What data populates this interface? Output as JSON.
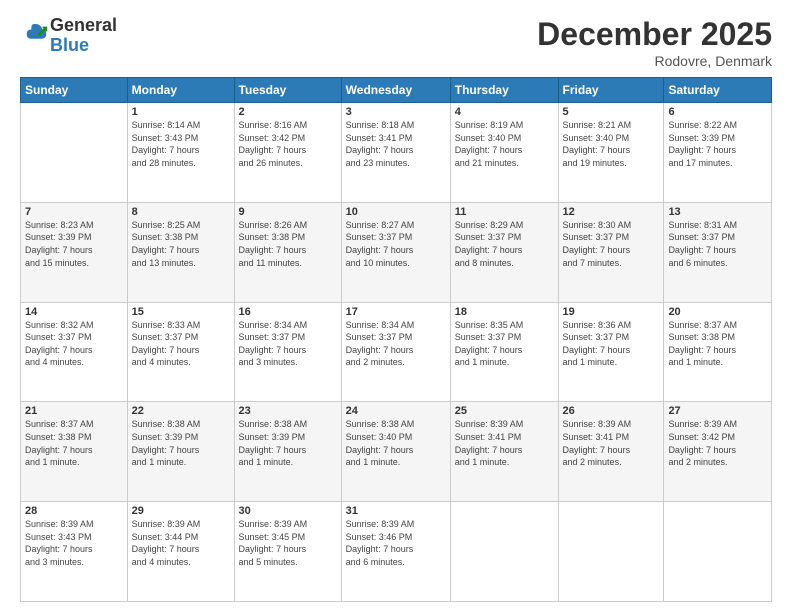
{
  "logo": {
    "general": "General",
    "blue": "Blue"
  },
  "header": {
    "title": "December 2025",
    "location": "Rodovre, Denmark"
  },
  "weekdays": [
    "Sunday",
    "Monday",
    "Tuesday",
    "Wednesday",
    "Thursday",
    "Friday",
    "Saturday"
  ],
  "weeks": [
    [
      {
        "day": "",
        "info": ""
      },
      {
        "day": "1",
        "info": "Sunrise: 8:14 AM\nSunset: 3:43 PM\nDaylight: 7 hours\nand 28 minutes."
      },
      {
        "day": "2",
        "info": "Sunrise: 8:16 AM\nSunset: 3:42 PM\nDaylight: 7 hours\nand 26 minutes."
      },
      {
        "day": "3",
        "info": "Sunrise: 8:18 AM\nSunset: 3:41 PM\nDaylight: 7 hours\nand 23 minutes."
      },
      {
        "day": "4",
        "info": "Sunrise: 8:19 AM\nSunset: 3:40 PM\nDaylight: 7 hours\nand 21 minutes."
      },
      {
        "day": "5",
        "info": "Sunrise: 8:21 AM\nSunset: 3:40 PM\nDaylight: 7 hours\nand 19 minutes."
      },
      {
        "day": "6",
        "info": "Sunrise: 8:22 AM\nSunset: 3:39 PM\nDaylight: 7 hours\nand 17 minutes."
      }
    ],
    [
      {
        "day": "7",
        "info": "Sunrise: 8:23 AM\nSunset: 3:39 PM\nDaylight: 7 hours\nand 15 minutes."
      },
      {
        "day": "8",
        "info": "Sunrise: 8:25 AM\nSunset: 3:38 PM\nDaylight: 7 hours\nand 13 minutes."
      },
      {
        "day": "9",
        "info": "Sunrise: 8:26 AM\nSunset: 3:38 PM\nDaylight: 7 hours\nand 11 minutes."
      },
      {
        "day": "10",
        "info": "Sunrise: 8:27 AM\nSunset: 3:37 PM\nDaylight: 7 hours\nand 10 minutes."
      },
      {
        "day": "11",
        "info": "Sunrise: 8:29 AM\nSunset: 3:37 PM\nDaylight: 7 hours\nand 8 minutes."
      },
      {
        "day": "12",
        "info": "Sunrise: 8:30 AM\nSunset: 3:37 PM\nDaylight: 7 hours\nand 7 minutes."
      },
      {
        "day": "13",
        "info": "Sunrise: 8:31 AM\nSunset: 3:37 PM\nDaylight: 7 hours\nand 6 minutes."
      }
    ],
    [
      {
        "day": "14",
        "info": "Sunrise: 8:32 AM\nSunset: 3:37 PM\nDaylight: 7 hours\nand 4 minutes."
      },
      {
        "day": "15",
        "info": "Sunrise: 8:33 AM\nSunset: 3:37 PM\nDaylight: 7 hours\nand 4 minutes."
      },
      {
        "day": "16",
        "info": "Sunrise: 8:34 AM\nSunset: 3:37 PM\nDaylight: 7 hours\nand 3 minutes."
      },
      {
        "day": "17",
        "info": "Sunrise: 8:34 AM\nSunset: 3:37 PM\nDaylight: 7 hours\nand 2 minutes."
      },
      {
        "day": "18",
        "info": "Sunrise: 8:35 AM\nSunset: 3:37 PM\nDaylight: 7 hours\nand 1 minute."
      },
      {
        "day": "19",
        "info": "Sunrise: 8:36 AM\nSunset: 3:37 PM\nDaylight: 7 hours\nand 1 minute."
      },
      {
        "day": "20",
        "info": "Sunrise: 8:37 AM\nSunset: 3:38 PM\nDaylight: 7 hours\nand 1 minute."
      }
    ],
    [
      {
        "day": "21",
        "info": "Sunrise: 8:37 AM\nSunset: 3:38 PM\nDaylight: 7 hours\nand 1 minute."
      },
      {
        "day": "22",
        "info": "Sunrise: 8:38 AM\nSunset: 3:39 PM\nDaylight: 7 hours\nand 1 minute."
      },
      {
        "day": "23",
        "info": "Sunrise: 8:38 AM\nSunset: 3:39 PM\nDaylight: 7 hours\nand 1 minute."
      },
      {
        "day": "24",
        "info": "Sunrise: 8:38 AM\nSunset: 3:40 PM\nDaylight: 7 hours\nand 1 minute."
      },
      {
        "day": "25",
        "info": "Sunrise: 8:39 AM\nSunset: 3:41 PM\nDaylight: 7 hours\nand 1 minute."
      },
      {
        "day": "26",
        "info": "Sunrise: 8:39 AM\nSunset: 3:41 PM\nDaylight: 7 hours\nand 2 minutes."
      },
      {
        "day": "27",
        "info": "Sunrise: 8:39 AM\nSunset: 3:42 PM\nDaylight: 7 hours\nand 2 minutes."
      }
    ],
    [
      {
        "day": "28",
        "info": "Sunrise: 8:39 AM\nSunset: 3:43 PM\nDaylight: 7 hours\nand 3 minutes."
      },
      {
        "day": "29",
        "info": "Sunrise: 8:39 AM\nSunset: 3:44 PM\nDaylight: 7 hours\nand 4 minutes."
      },
      {
        "day": "30",
        "info": "Sunrise: 8:39 AM\nSunset: 3:45 PM\nDaylight: 7 hours\nand 5 minutes."
      },
      {
        "day": "31",
        "info": "Sunrise: 8:39 AM\nSunset: 3:46 PM\nDaylight: 7 hours\nand 6 minutes."
      },
      {
        "day": "",
        "info": ""
      },
      {
        "day": "",
        "info": ""
      },
      {
        "day": "",
        "info": ""
      }
    ]
  ]
}
